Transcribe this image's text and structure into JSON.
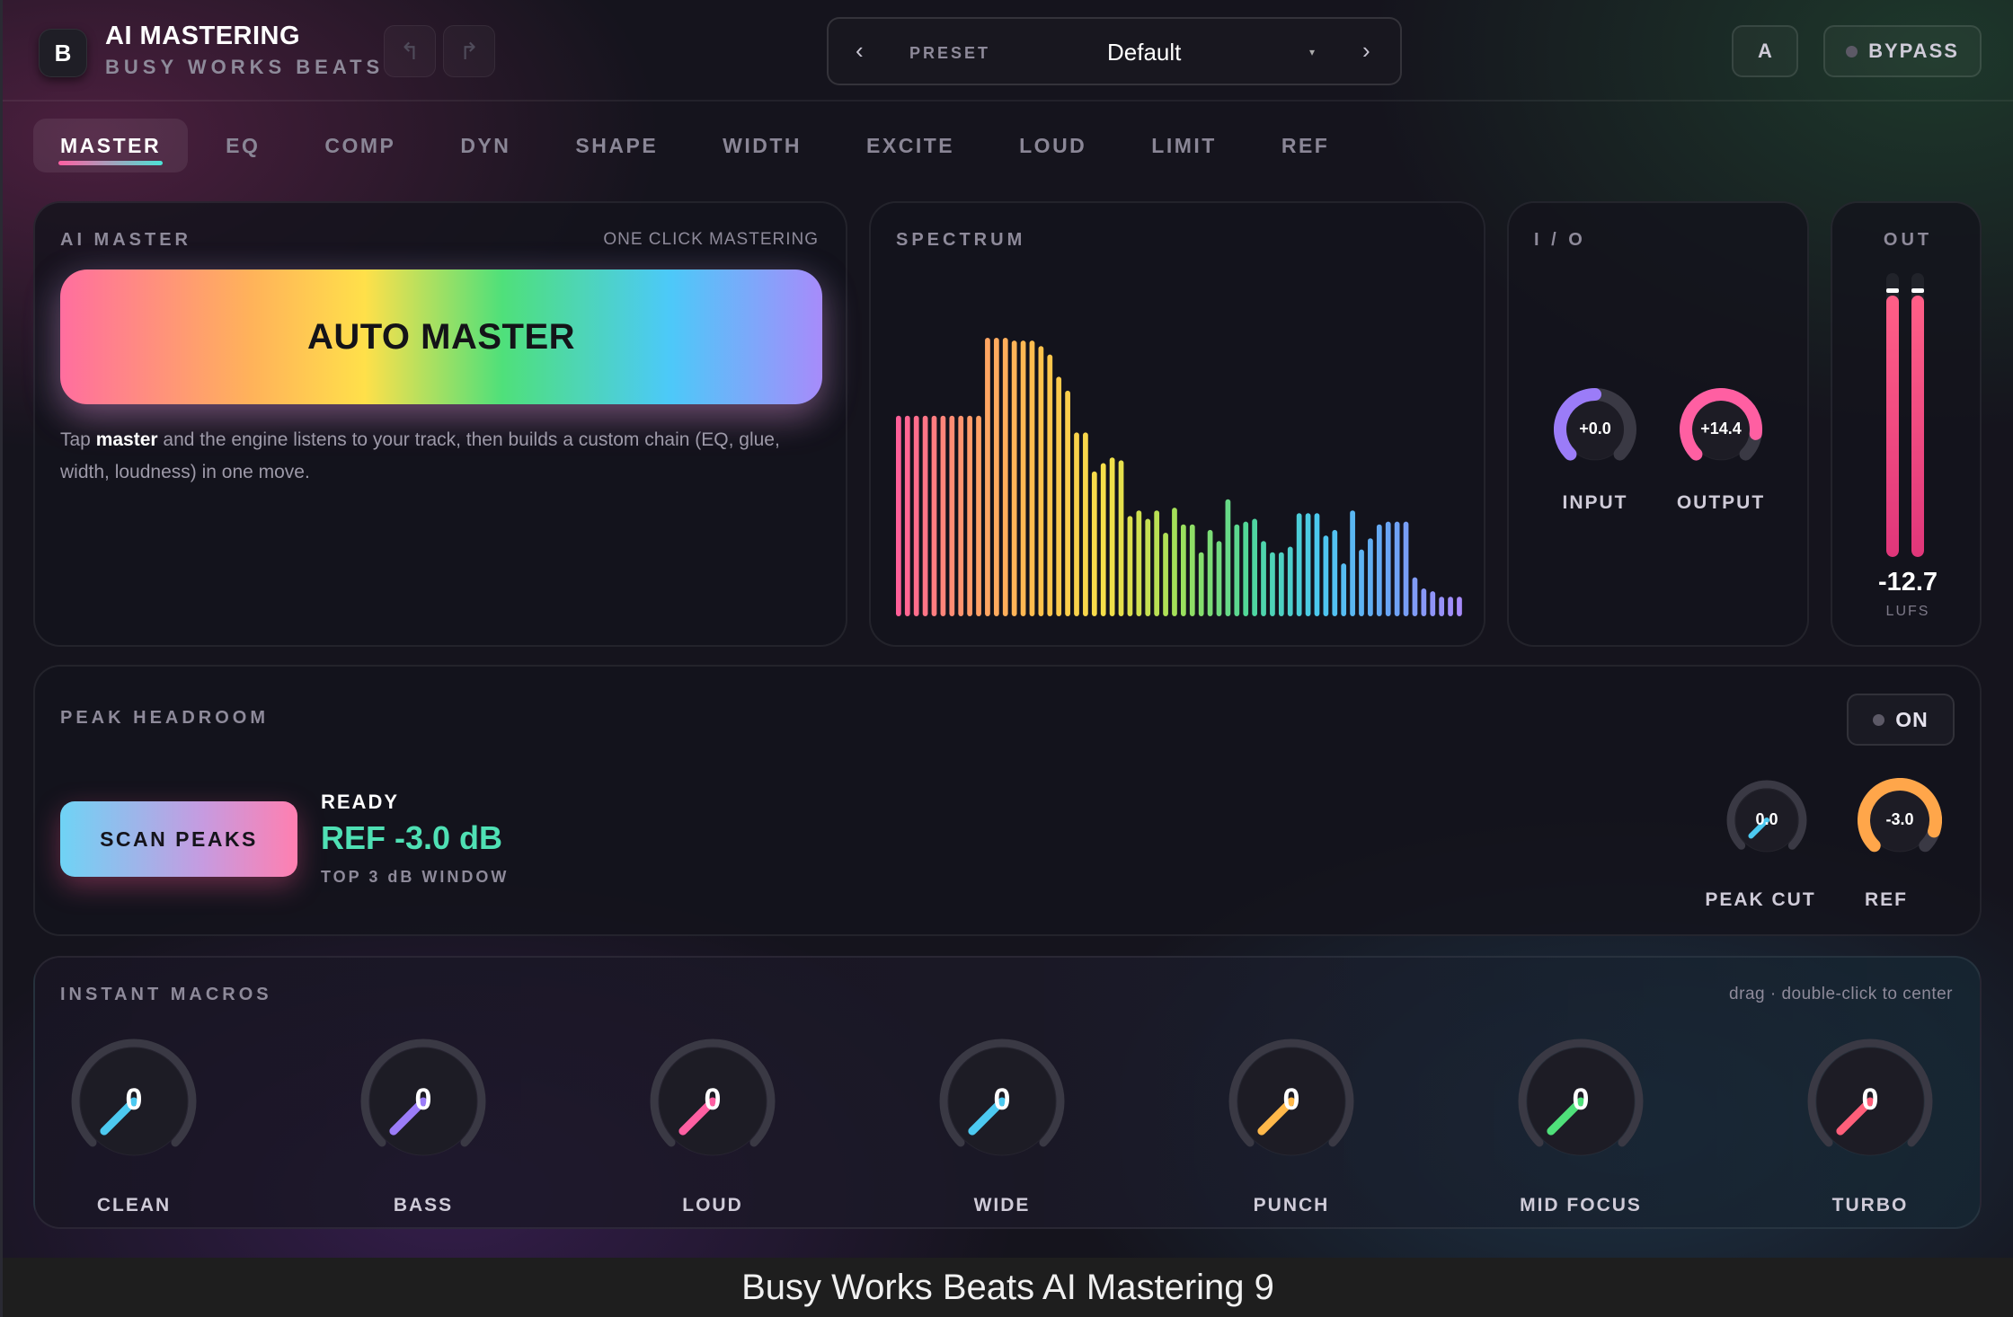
{
  "header": {
    "logo": "B",
    "title": "AI MASTERING",
    "subtitle": "BUSY WORKS BEATS",
    "preset_label": "PRESET",
    "preset_value": "Default",
    "prev": "‹",
    "next": "›",
    "caret": "▾",
    "ab_label": "A",
    "bypass_label": "BYPASS"
  },
  "tabs": [
    "MASTER",
    "EQ",
    "COMP",
    "DYN",
    "SHAPE",
    "WIDTH",
    "EXCITE",
    "LOUD",
    "LIMIT",
    "REF"
  ],
  "ai_master": {
    "title": "AI MASTER",
    "tag": "ONE CLICK MASTERING",
    "button": "AUTO MASTER",
    "desc_pre": "Tap ",
    "desc_bold": "master",
    "desc_post": " and the engine listens to your track, then builds a custom chain (EQ, glue, width, loudness) in one move."
  },
  "spectrum": {
    "title": "SPECTRUM",
    "levels": [
      0.72,
      0.72,
      0.72,
      0.72,
      0.72,
      0.72,
      0.72,
      0.72,
      0.72,
      0.72,
      1.0,
      1.0,
      1.0,
      0.99,
      0.99,
      0.99,
      0.97,
      0.94,
      0.86,
      0.81,
      0.66,
      0.66,
      0.52,
      0.55,
      0.57,
      0.56,
      0.36,
      0.38,
      0.35,
      0.38,
      0.3,
      0.39,
      0.33,
      0.33,
      0.23,
      0.31,
      0.27,
      0.42,
      0.33,
      0.34,
      0.35,
      0.27,
      0.23,
      0.23,
      0.25,
      0.37,
      0.37,
      0.37,
      0.29,
      0.31,
      0.19,
      0.38,
      0.24,
      0.28,
      0.33,
      0.34,
      0.34,
      0.34,
      0.14,
      0.1,
      0.09,
      0.07,
      0.07,
      0.07
    ],
    "colors": [
      "#ff5f98",
      "#ff9b6a",
      "#ffc14d",
      "#f5e14a",
      "#9fe05a",
      "#4fd79b",
      "#4cc9f0",
      "#6aa5f5",
      "#a78bfa"
    ]
  },
  "io": {
    "title": "I / O",
    "input": {
      "label": "INPUT",
      "value": "+0.0",
      "level": 0.5,
      "color": "#9b7cf8"
    },
    "output": {
      "label": "OUTPUT",
      "value": "+14.4",
      "level": 0.86,
      "color": "#ff5fa2"
    }
  },
  "out_meter": {
    "title": "OUT",
    "value": "-12.7",
    "unit": "LUFS",
    "levels": [
      0.92,
      0.92
    ],
    "peaks": [
      0.93,
      0.93
    ]
  },
  "peak_headroom": {
    "title": "PEAK HEADROOM",
    "toggle": "ON",
    "scan_button": "SCAN PEAKS",
    "status": "READY",
    "ref_value": "REF -3.0 dB",
    "window": "TOP 3 dB WINDOW",
    "peak_cut": {
      "label": "PEAK CUT",
      "value": "0.0",
      "level": 0.0,
      "color": "#4cc9f0"
    },
    "ref": {
      "label": "REF",
      "value": "-3.0",
      "level": 0.9,
      "color": "#ffa64a"
    }
  },
  "macros": {
    "title": "INSTANT MACROS",
    "hint": "drag · double-click to center",
    "items": [
      {
        "label": "CLEAN",
        "value": "0",
        "color": "#4cc9f0"
      },
      {
        "label": "BASS",
        "value": "0",
        "color": "#9b7cf8"
      },
      {
        "label": "LOUD",
        "value": "0",
        "color": "#ff5fa2"
      },
      {
        "label": "WIDE",
        "value": "0",
        "color": "#4cc9f0"
      },
      {
        "label": "PUNCH",
        "value": "0",
        "color": "#ffb84a"
      },
      {
        "label": "MID FOCUS",
        "value": "0",
        "color": "#4fe07a"
      },
      {
        "label": "TURBO",
        "value": "0",
        "color": "#ff5f7a"
      }
    ]
  },
  "caption": "Busy Works Beats AI Mastering 9"
}
